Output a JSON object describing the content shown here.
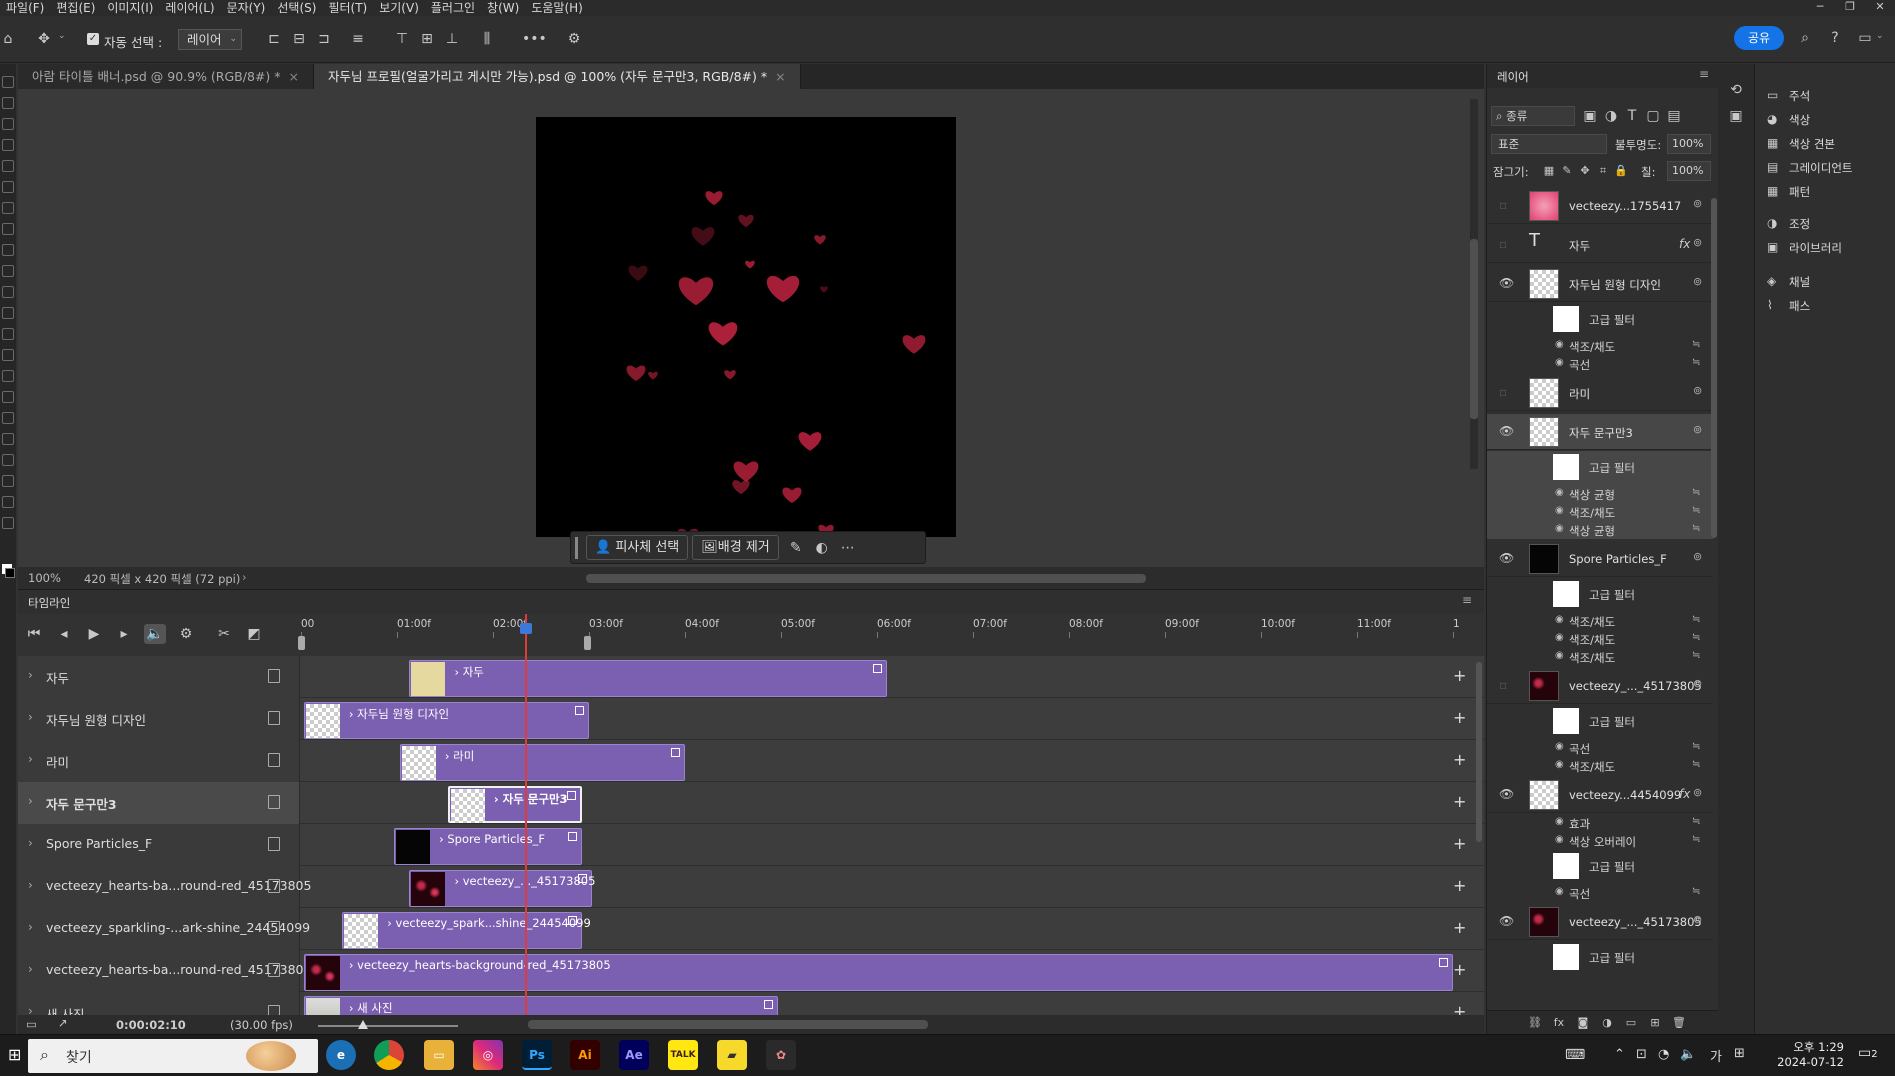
{
  "menu": [
    "파일(F)",
    "편집(E)",
    "이미지(I)",
    "레이어(L)",
    "문자(Y)",
    "선택(S)",
    "필터(T)",
    "보기(V)",
    "플러그인",
    "창(W)",
    "도움말(H)"
  ],
  "options": {
    "auto_select_label": "자동 선택 :",
    "auto_select_value": "레이어",
    "share_label": "공유"
  },
  "tabs": [
    {
      "label": "아람 타이틀 배너.psd @ 90.9% (RGB/8#) *",
      "active": false
    },
    {
      "label": "자두님 프로필(얼굴가리고 게시만 가능).psd @ 100% (자두 문구만3, RGB/8#) *",
      "active": true
    }
  ],
  "context_bar": {
    "select_subject": "피사체 선택",
    "remove_bg": "배경 제거"
  },
  "status": {
    "zoom": "100%",
    "size": "420 픽셀 x 420 픽셀 (72 ppi)"
  },
  "timeline": {
    "title": "타임라인",
    "ruler": [
      "00",
      "01:00f",
      "02:00f",
      "03:00f",
      "04:00f",
      "05:00f",
      "06:00f",
      "07:00f",
      "08:00f",
      "09:00f",
      "10:00f",
      "11:00f",
      "1"
    ],
    "current_time": "0:00:02:10",
    "fps": "(30.00 fps)",
    "playhead_seconds": 2.33,
    "tracks": [
      {
        "name": "자두",
        "clip": "자두",
        "start": 1.13,
        "end": 6.1,
        "thumb": "text",
        "selected": false
      },
      {
        "name": "자두님 원형 디자인",
        "clip": "자두님 원형 디자인",
        "start": 0.03,
        "end": 3.0,
        "thumb": "checker",
        "selected": false
      },
      {
        "name": "라미",
        "clip": "라미",
        "start": 1.03,
        "end": 4.0,
        "thumb": "checker",
        "selected": false
      },
      {
        "name": "자두 문구만3",
        "clip": "자두 문구만3",
        "start": 1.53,
        "end": 2.93,
        "thumb": "checker",
        "selected": true
      },
      {
        "name": "Spore Particles_F",
        "clip": "Spore Particles_F",
        "start": 0.97,
        "end": 2.93,
        "thumb": "dark",
        "selected": false
      },
      {
        "name": "vecteezy_hearts-ba...round-red_45173805",
        "clip": "vecteezy_..._45173805",
        "start": 1.13,
        "end": 3.03,
        "thumb": "red",
        "selected": false
      },
      {
        "name": "vecteezy_sparkling-...ark-shine_24454099",
        "clip": "vecteezy_spark...shine_24454099",
        "start": 0.43,
        "end": 2.93,
        "thumb": "checker",
        "selected": false
      },
      {
        "name": "vecteezy_hearts-ba...round-red_45173805",
        "clip": "vecteezy_hearts-background-red_45173805",
        "start": 0.03,
        "end": 12.0,
        "thumb": "red",
        "selected": false
      },
      {
        "name": "새 사진",
        "clip": "새 사진",
        "start": 0.03,
        "end": 4.97,
        "thumb": "photo",
        "selected": false
      }
    ]
  },
  "layers_panel": {
    "title": "레이어",
    "filter": "종류",
    "blend": "표준",
    "opacity_label": "불투명도:",
    "opacity": "100%",
    "lock_label": "잠그기:",
    "fill_label": "칠:",
    "fill": "100%",
    "layers": [
      {
        "name": "vecteezy...1755417",
        "thumb": "pink",
        "visible": false,
        "subs": []
      },
      {
        "name": "자두",
        "thumb": "text",
        "visible": false,
        "fx": "fx",
        "subs": []
      },
      {
        "name": "자두님 원형 디자인",
        "thumb": "checker",
        "visible": true,
        "subs": [
          "고급 필터",
          "색조/채도",
          "곡선"
        ]
      },
      {
        "name": "라미",
        "thumb": "checker",
        "visible": false,
        "subs": []
      },
      {
        "name": "자두 문구만3",
        "thumb": "checker",
        "visible": true,
        "selected": true,
        "subs": [
          "고급 필터",
          "색상 균형",
          "색조/채도",
          "색상 균형"
        ]
      },
      {
        "name": "Spore Particles_F",
        "thumb": "dark",
        "visible": true,
        "subs": [
          "고급 필터",
          "색조/채도",
          "색조/채도",
          "색조/채도"
        ]
      },
      {
        "name": "vecteezy_..._45173805",
        "thumb": "red",
        "visible": false,
        "subs": [
          "고급 필터",
          "곡선",
          "색조/채도"
        ]
      },
      {
        "name": "vecteezy...4454099",
        "thumb": "checker",
        "visible": true,
        "fx": "fx",
        "subs": [
          "효과",
          "색상 오버레이",
          "고급 필터",
          "곡선"
        ]
      },
      {
        "name": "vecteezy_..._45173805",
        "thumb": "red",
        "visible": true,
        "subs": [
          "고급 필터"
        ]
      }
    ]
  },
  "right_panels": [
    {
      "label": "주석",
      "icon": "comment-icon",
      "glyph": "▭"
    },
    {
      "label": "색상",
      "icon": "color-icon",
      "glyph": "◕"
    },
    {
      "label": "색상 견본",
      "icon": "swatches-icon",
      "glyph": "▦"
    },
    {
      "label": "그레이디언트",
      "icon": "gradient-icon",
      "glyph": "▤"
    },
    {
      "label": "패턴",
      "icon": "pattern-icon",
      "glyph": "▦"
    },
    {
      "label": "조정",
      "icon": "adjustment-icon",
      "glyph": "◑"
    },
    {
      "label": "라이브러리",
      "icon": "library-icon",
      "glyph": "▣"
    },
    {
      "label": "채널",
      "icon": "channels-icon",
      "glyph": "◈"
    },
    {
      "label": "패스",
      "icon": "paths-icon",
      "glyph": "⌇"
    }
  ],
  "taskbar": {
    "search": "찾기",
    "ampm": "오후",
    "time": "1:29",
    "date": "2024-07-12",
    "ime": "가",
    "notif": "2"
  },
  "colors": {
    "accent": "#1473e6",
    "clip": "#7b5fb0",
    "playhead": "#e03b3b",
    "heart": "#c0233f"
  }
}
